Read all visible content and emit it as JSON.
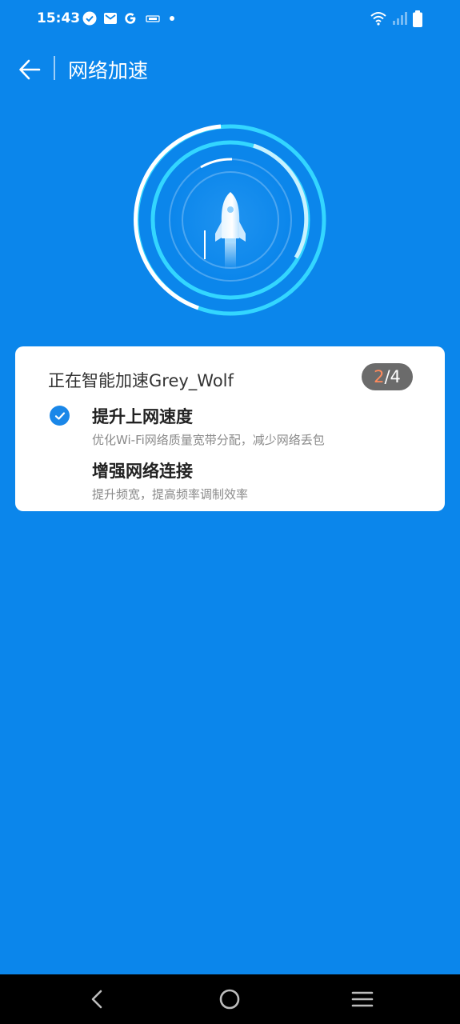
{
  "status_bar": {
    "time": "15:43",
    "icons": [
      "check-circle-icon",
      "mail-icon",
      "google-icon",
      "notification-icon",
      "dot-icon"
    ],
    "right_icons": [
      "wifi-icon",
      "signal-icon",
      "battery-icon"
    ]
  },
  "header": {
    "title": "网络加速"
  },
  "card": {
    "title": "正在智能加速Grey_Wolf",
    "progress": {
      "current": "2",
      "separator": "/",
      "total": "4"
    },
    "steps": [
      {
        "title": "提升上网速度",
        "description": "优化Wi-Fi网络质量宽带分配，减少网络丢包",
        "completed": true
      },
      {
        "title": "增强网络连接",
        "description": "提升频宽，提高频率调制效率",
        "completed": false
      }
    ]
  },
  "nav_bar": {
    "buttons": [
      "back-icon",
      "home-icon",
      "menu-icon"
    ]
  },
  "colors": {
    "background": "#0b86eb",
    "accent": "#1a87e8",
    "ring_cyan": "#33d6ff",
    "progress_highlight": "#ff8a5c"
  }
}
